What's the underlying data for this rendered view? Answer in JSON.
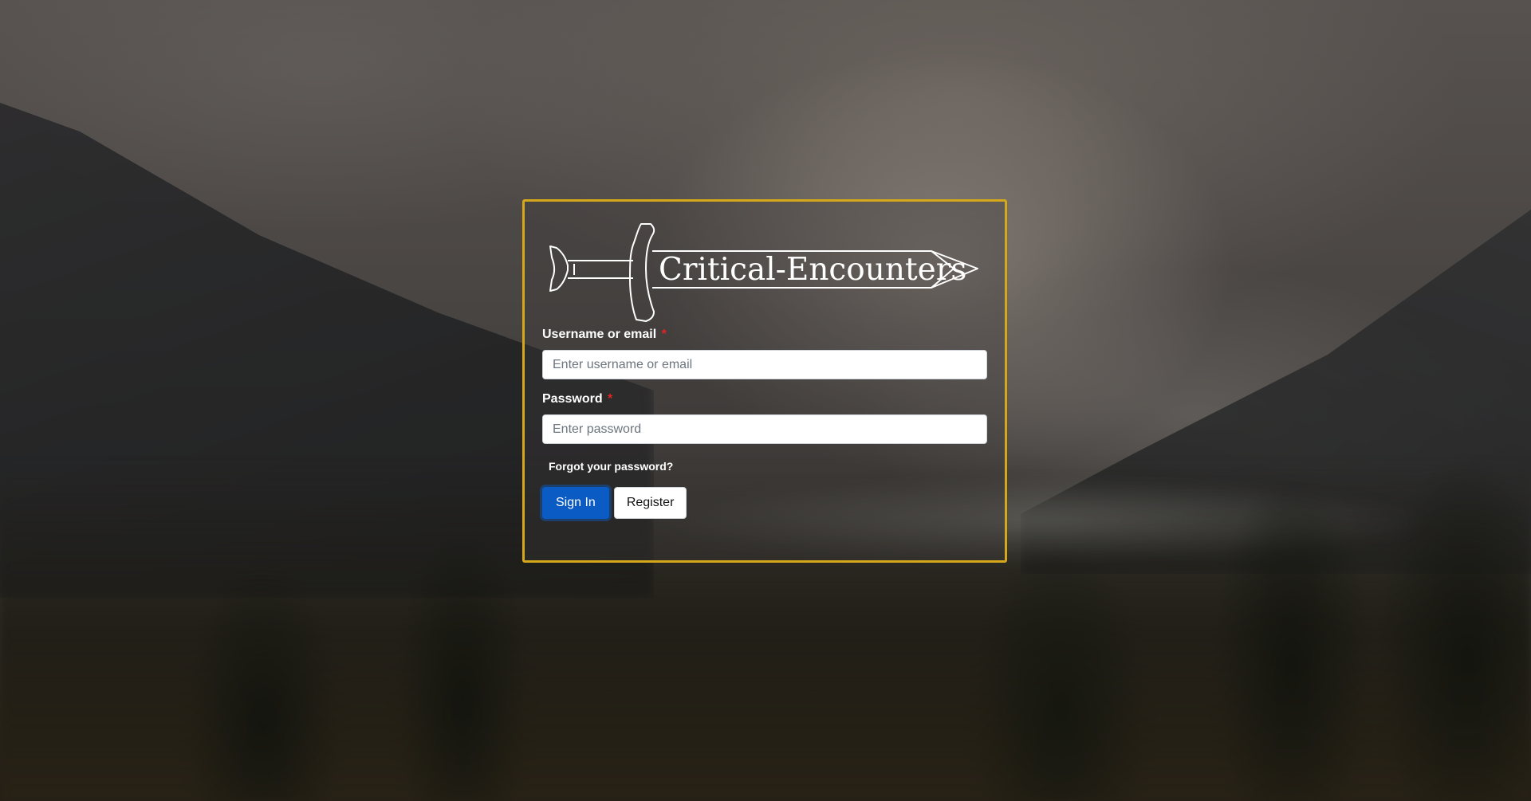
{
  "brand": {
    "logo_text": "Critical-Encounters"
  },
  "form": {
    "username": {
      "label": "Username or email",
      "required_marker": "*",
      "placeholder": "Enter username or email",
      "value": ""
    },
    "password": {
      "label": "Password",
      "required_marker": "*",
      "placeholder": "Enter password",
      "value": ""
    },
    "forgot_link": "Forgot your password?",
    "sign_in_label": "Sign In",
    "register_label": "Register"
  },
  "colors": {
    "card_border": "#d4a81a",
    "primary_button": "#0a5bc4",
    "required_marker": "#e02424"
  },
  "icons": {
    "logo_emblem": "sword-icon"
  }
}
